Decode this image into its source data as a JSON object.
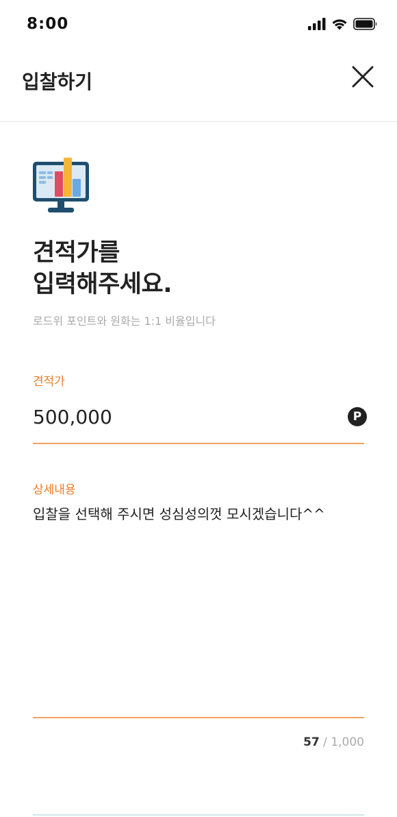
{
  "status_bar": {
    "time": "8:00",
    "icons": [
      "cellular-signal-icon",
      "wifi-icon",
      "battery-icon"
    ]
  },
  "header": {
    "title": "입찰하기",
    "close_icon": "close-icon"
  },
  "content": {
    "illustration": "monitor-chart-icon",
    "headline_line1": "견적가를",
    "headline_line2": "입력해주세요.",
    "subtext": "로드위 포인트와 원화는 1:1 비율입니다"
  },
  "price_field": {
    "label": "견적가",
    "value": "500,000",
    "unit_badge": "P"
  },
  "detail_field": {
    "label": "상세내용",
    "value": "입찰을 선택해 주시면 성심성의껏 모시겠습니다^^",
    "char_count_current": "57",
    "char_count_separator": " / ",
    "char_count_max": "1,000"
  },
  "colors": {
    "accent": "#f07a28",
    "underline": "#f0a15e",
    "text": "#222222",
    "muted": "#aaaaaa"
  }
}
